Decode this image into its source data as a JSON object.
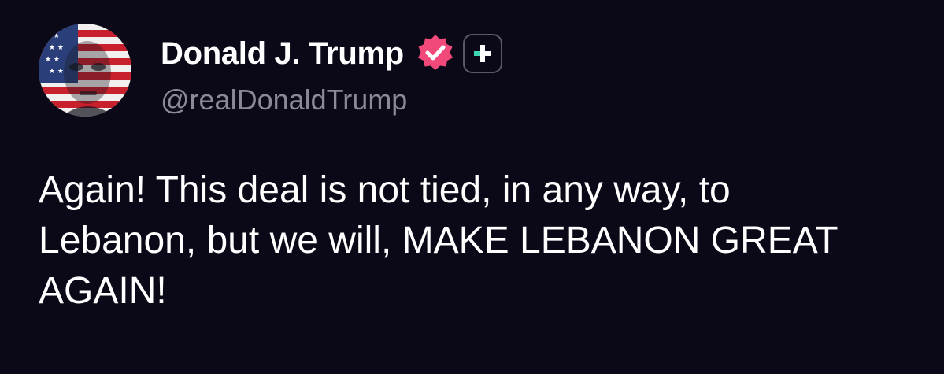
{
  "author": {
    "display_name": "Donald J. Trump",
    "handle": "@realDonaldTrump",
    "avatar_icon": "avatar-flag-portrait",
    "verified_icon": "verified-badge-icon",
    "verified_color": "#f0497a",
    "plus_icon": "plus-icon",
    "plus_accent_color": "#3ed6b4"
  },
  "post": {
    "text": "Again! This deal is not tied, in any way, to\nLebanon, but we will, MAKE LEBANON GREAT\nAGAIN!"
  },
  "colors": {
    "background": "#0b0917",
    "text_primary": "#ffffff",
    "text_secondary": "#8a8a96"
  }
}
